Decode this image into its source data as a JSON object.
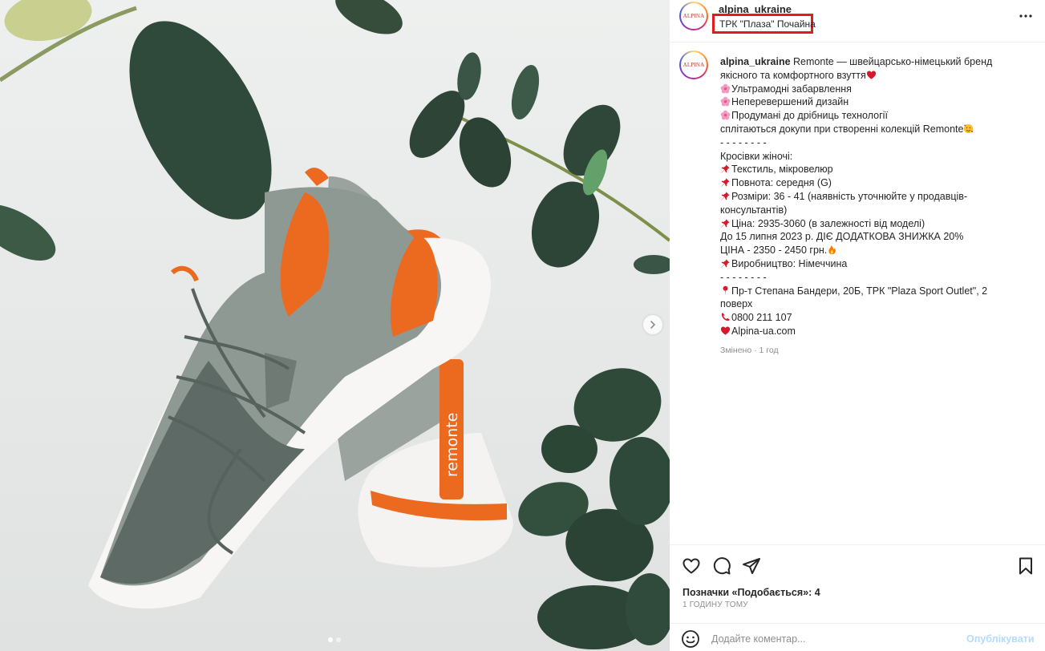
{
  "post": {
    "username": "alpina_ukraine",
    "location": "ТРК \"Плаза\" Почайна",
    "avatar_text": "ALPINA",
    "brand_print": "remonte"
  },
  "caption": {
    "lines": [
      {
        "user": "alpina_ukraine",
        "text": " Remonte — швейцарсько-німецький бренд"
      },
      {
        "text": "якісного та комфортного взуття",
        "emoji_after": "heart-icon"
      },
      {
        "emoji": "blossom-icon",
        "text": "Ультрамодні забарвлення"
      },
      {
        "emoji": "blossom-icon",
        "text": "Неперевершений дизайн"
      },
      {
        "emoji": "blossom-icon",
        "text": "Продумані до дрібниць технології"
      },
      {
        "text": "сплітаються докупи при створенні колекцій Remonte",
        "emoji_after": "smiling-face-hearts-icon"
      },
      {
        "text": "- - - - - - - -"
      },
      {
        "text": "Кросівки жіночі:"
      },
      {
        "emoji": "pushpin-icon",
        "text": "Текстиль, мікровелюр"
      },
      {
        "emoji": "pushpin-icon",
        "text": "Повнота: середня (G)"
      },
      {
        "emoji": "pushpin-icon",
        "text": "Розміри: 36 - 41 (наявність уточнюйте у продавців-"
      },
      {
        "text": "консультантів)"
      },
      {
        "emoji": "pushpin-icon",
        "text": "Ціна: 2935-3060 (в залежності від моделі)"
      },
      {
        "text": "До 15 липня 2023 р. ДІЄ ДОДАТКОВА ЗНИЖКА 20%"
      },
      {
        "text": "ЦІНА - 2350 - 2450 грн.",
        "emoji_after": "fire-icon"
      },
      {
        "emoji": "pushpin-icon",
        "text": "Виробництво: Німеччина"
      },
      {
        "text": "- - - - - - - -"
      },
      {
        "emoji": "round-pushpin-icon",
        "text": "Пр-т Степана Бандери, 20Б, ТРК \"Plaza Sport Outlet\", 2"
      },
      {
        "text": "поверх"
      },
      {
        "emoji": "telephone-icon",
        "text": "0800 211 107"
      },
      {
        "emoji": "heart-icon",
        "text": "Alpina-ua.com"
      }
    ],
    "edited": "Змінено · 1 год"
  },
  "likes_text": "Позначки «Подобається»: 4",
  "time_ago": "1 ГОДИНУ ТОМУ",
  "comment": {
    "placeholder": "Додайте коментар...",
    "post_label": "Опублікувати"
  },
  "carousel": {
    "total": 2,
    "current": 1
  },
  "colors": {
    "location_highlight": "#e21b23",
    "accent_blue": "#b3dbff",
    "shoe_orange": "#ec6a1f",
    "shoe_gray": "#8b9590"
  }
}
